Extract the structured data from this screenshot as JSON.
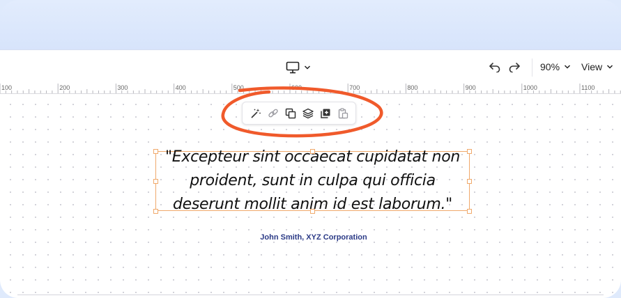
{
  "toolbar": {
    "device_icon": "monitor-icon",
    "zoom_value": "90%",
    "view_label": "View"
  },
  "ruler": {
    "labels": [
      "100",
      "200",
      "300",
      "400",
      "500",
      "600",
      "700",
      "800",
      "900",
      "1000",
      "1100"
    ]
  },
  "floating_toolbar": {
    "icons": [
      "magic-wand-icon",
      "link-icon",
      "duplicate-icon",
      "layers-icon",
      "copy-style-icon",
      "paste-style-icon"
    ]
  },
  "canvas": {
    "quote": "\"Excepteur sint occaecat cupidatat non proident, sunt in culpa qui officia deserunt mollit anim id est laborum.\"",
    "attribution": "John Smith, XYZ Corporation"
  },
  "colors": {
    "highlight": "#f05a2b",
    "selection": "#f0a96b",
    "attribution": "#2b3a86"
  }
}
